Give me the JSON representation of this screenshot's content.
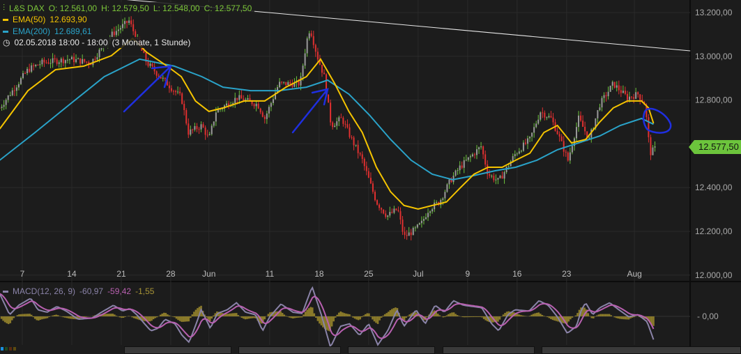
{
  "legend": {
    "symbol": "L&S DAX",
    "open": "O: 12.561,00",
    "high": "H: 12.579,50",
    "low": "L: 12.548,00",
    "close": "C: 12.577,50",
    "ema50_label": "EMA(50)",
    "ema50_value": "12.693,90",
    "ema200_label": "EMA(200)",
    "ema200_value": "12.689,61",
    "period": "02.05.2018 18:00 - 18:00",
    "range": "(3 Monate, 1 Stunde)"
  },
  "macd_legend": {
    "label": "MACD(12, 26, 9)",
    "macd": "-60,97",
    "signal": "-59,42",
    "hist": "-1,55"
  },
  "last_price_tag": "12.577,50",
  "colors": {
    "up": "#6cc43c",
    "down": "#e03030",
    "ema50": "#f5c400",
    "ema200": "#2aa3c9",
    "macd": "#8a83a8",
    "signal": "#b860b0",
    "hist": "#8a7a2a",
    "annotation": "#1f2fe0"
  },
  "chart_data": {
    "type": "line",
    "title": "L&S DAX (3 Monate, 1 Stunde)",
    "x_unit": "days since 7 May 2018",
    "xlim": [
      -3.2,
      94.5
    ],
    "ylim": [
      12000,
      13200
    ],
    "x_ticks": [
      {
        "d": 0,
        "label": "7"
      },
      {
        "d": 7,
        "label": "14"
      },
      {
        "d": 14,
        "label": "21"
      },
      {
        "d": 21,
        "label": "28"
      },
      {
        "d": 26.4,
        "label": "Jun"
      },
      {
        "d": 35,
        "label": "11"
      },
      {
        "d": 42,
        "label": "18"
      },
      {
        "d": 49,
        "label": "25"
      },
      {
        "d": 56,
        "label": "Jul"
      },
      {
        "d": 63,
        "label": "9"
      },
      {
        "d": 70,
        "label": "16"
      },
      {
        "d": 77,
        "label": "23"
      },
      {
        "d": 86.6,
        "label": "Aug"
      }
    ],
    "y_ticks": [
      {
        "v": 13200,
        "label": "13.200,00"
      },
      {
        "v": 13000,
        "label": "13.000,00"
      },
      {
        "v": 12800,
        "label": "12.800,00"
      },
      {
        "v": 12600,
        "label": "12.600,00"
      },
      {
        "v": 12400,
        "label": "12.400,00"
      },
      {
        "v": 12200,
        "label": "12.200,00"
      },
      {
        "v": 12000,
        "label": "12.000,00"
      }
    ],
    "price": [
      [
        -3.2,
        12764
      ],
      [
        0.8,
        12939
      ],
      [
        2.8,
        12971
      ],
      [
        6.7,
        12987
      ],
      [
        9.7,
        12971
      ],
      [
        12.6,
        13098
      ],
      [
        15.1,
        13162
      ],
      [
        17.6,
        12971
      ],
      [
        19.5,
        12907
      ],
      [
        22.5,
        12811
      ],
      [
        23.5,
        12652
      ],
      [
        25.4,
        12684
      ],
      [
        26.4,
        12620
      ],
      [
        27.4,
        12748
      ],
      [
        30.4,
        12811
      ],
      [
        33.3,
        12780
      ],
      [
        34.3,
        12716
      ],
      [
        36.3,
        12875
      ],
      [
        39.3,
        12875
      ],
      [
        40.2,
        13066
      ],
      [
        40.7,
        13130
      ],
      [
        41.7,
        13003
      ],
      [
        42.7,
        12907
      ],
      [
        43.7,
        12684
      ],
      [
        45.2,
        12716
      ],
      [
        46.6,
        12620
      ],
      [
        48.1,
        12525
      ],
      [
        50.1,
        12334
      ],
      [
        51.6,
        12270
      ],
      [
        53.1,
        12302
      ],
      [
        54.0,
        12174
      ],
      [
        55.5,
        12206
      ],
      [
        56.5,
        12238
      ],
      [
        57.5,
        12302
      ],
      [
        59.0,
        12334
      ],
      [
        60.5,
        12429
      ],
      [
        61.9,
        12493
      ],
      [
        64.9,
        12588
      ],
      [
        65.9,
        12461
      ],
      [
        67.4,
        12429
      ],
      [
        69.8,
        12557
      ],
      [
        71.8,
        12620
      ],
      [
        73.3,
        12748
      ],
      [
        74.8,
        12716
      ],
      [
        75.7,
        12652
      ],
      [
        77.2,
        12525
      ],
      [
        78.7,
        12716
      ],
      [
        80.2,
        12620
      ],
      [
        81.7,
        12780
      ],
      [
        83.6,
        12875
      ],
      [
        85.6,
        12811
      ],
      [
        87.1,
        12827
      ],
      [
        88.1,
        12780
      ],
      [
        88.8,
        12557
      ],
      [
        89.5,
        12577.5
      ]
    ],
    "ema50": [
      [
        -3.2,
        12668
      ],
      [
        0.8,
        12843
      ],
      [
        4.7,
        12939
      ],
      [
        8.7,
        12955
      ],
      [
        12.6,
        13003
      ],
      [
        15.6,
        13082
      ],
      [
        17.6,
        13018
      ],
      [
        20.5,
        12955
      ],
      [
        22.5,
        12907
      ],
      [
        24.5,
        12796
      ],
      [
        26.4,
        12748
      ],
      [
        28.4,
        12764
      ],
      [
        31.4,
        12796
      ],
      [
        34.3,
        12796
      ],
      [
        37.3,
        12859
      ],
      [
        40.2,
        12907
      ],
      [
        42.2,
        12987
      ],
      [
        44.2,
        12875
      ],
      [
        46.2,
        12748
      ],
      [
        48.1,
        12652
      ],
      [
        50.1,
        12493
      ],
      [
        52.1,
        12381
      ],
      [
        54.0,
        12318
      ],
      [
        56.0,
        12302
      ],
      [
        58.0,
        12318
      ],
      [
        60.0,
        12334
      ],
      [
        61.9,
        12397
      ],
      [
        63.9,
        12461
      ],
      [
        65.9,
        12493
      ],
      [
        67.9,
        12493
      ],
      [
        69.8,
        12525
      ],
      [
        71.8,
        12557
      ],
      [
        73.8,
        12652
      ],
      [
        75.7,
        12684
      ],
      [
        77.7,
        12604
      ],
      [
        79.7,
        12620
      ],
      [
        81.7,
        12700
      ],
      [
        83.6,
        12764
      ],
      [
        85.6,
        12796
      ],
      [
        87.6,
        12796
      ],
      [
        88.6,
        12764
      ],
      [
        89.3,
        12693.9
      ]
    ],
    "ema200": [
      [
        -3.2,
        12525
      ],
      [
        1.8,
        12652
      ],
      [
        6.7,
        12780
      ],
      [
        11.6,
        12907
      ],
      [
        16.6,
        12987
      ],
      [
        21.5,
        12955
      ],
      [
        25.4,
        12907
      ],
      [
        28.4,
        12859
      ],
      [
        32.3,
        12843
      ],
      [
        36.3,
        12843
      ],
      [
        40.2,
        12859
      ],
      [
        43.2,
        12891
      ],
      [
        46.2,
        12827
      ],
      [
        49.1,
        12732
      ],
      [
        52.1,
        12620
      ],
      [
        55.0,
        12525
      ],
      [
        58.0,
        12461
      ],
      [
        60.9,
        12436
      ],
      [
        63.9,
        12455
      ],
      [
        66.9,
        12477
      ],
      [
        69.8,
        12493
      ],
      [
        72.8,
        12525
      ],
      [
        75.7,
        12573
      ],
      [
        78.7,
        12604
      ],
      [
        81.7,
        12636
      ],
      [
        84.6,
        12684
      ],
      [
        87.6,
        12716
      ],
      [
        89.3,
        12689.61
      ]
    ],
    "trendline": [
      [
        30.4,
        13213
      ],
      [
        94.5,
        13025
      ]
    ],
    "macd_panel": {
      "zero_label": "0,00",
      "macd": [
        [
          -3.2,
          55
        ],
        [
          -1.8,
          4
        ],
        [
          -0.5,
          27
        ],
        [
          1.2,
          44
        ],
        [
          2.2,
          16
        ],
        [
          3.5,
          10
        ],
        [
          4.9,
          24
        ],
        [
          6.2,
          13
        ],
        [
          7.9,
          -7
        ],
        [
          9.9,
          -4
        ],
        [
          11.2,
          10
        ],
        [
          12.9,
          27
        ],
        [
          14.2,
          13
        ],
        [
          15.2,
          19
        ],
        [
          16.2,
          4
        ],
        [
          17.6,
          -24
        ],
        [
          18.2,
          -35
        ],
        [
          19.2,
          -29
        ],
        [
          20.2,
          -7
        ],
        [
          21.6,
          -18
        ],
        [
          22.6,
          -46
        ],
        [
          23.6,
          -63
        ],
        [
          24.6,
          -18
        ],
        [
          25.3,
          16
        ],
        [
          26.3,
          -18
        ],
        [
          26.6,
          -29
        ],
        [
          27.6,
          7
        ],
        [
          29.0,
          16
        ],
        [
          30.3,
          33
        ],
        [
          31.6,
          10
        ],
        [
          33.0,
          4
        ],
        [
          34.0,
          -35
        ],
        [
          35.0,
          -1
        ],
        [
          36.6,
          30
        ],
        [
          38.3,
          10
        ],
        [
          39.6,
          7
        ],
        [
          41.0,
          72
        ],
        [
          42.3,
          4
        ],
        [
          43.6,
          -75
        ],
        [
          45.0,
          -24
        ],
        [
          46.3,
          -18
        ],
        [
          47.7,
          -46
        ],
        [
          49.0,
          -18
        ],
        [
          50.3,
          -69
        ],
        [
          51.7,
          -35
        ],
        [
          53.0,
          16
        ],
        [
          54.0,
          -24
        ],
        [
          55.0,
          -1
        ],
        [
          55.7,
          16
        ],
        [
          57.0,
          -18
        ],
        [
          58.4,
          27
        ],
        [
          59.7,
          10
        ],
        [
          61.0,
          38
        ],
        [
          62.4,
          27
        ],
        [
          63.7,
          24
        ],
        [
          65.0,
          21
        ],
        [
          66.4,
          -18
        ],
        [
          67.4,
          -35
        ],
        [
          68.7,
          4
        ],
        [
          69.7,
          16
        ],
        [
          71.7,
          13
        ],
        [
          73.1,
          38
        ],
        [
          74.4,
          27
        ],
        [
          75.7,
          -1
        ],
        [
          77.1,
          -41
        ],
        [
          78.4,
          -24
        ],
        [
          79.1,
          16
        ],
        [
          79.7,
          33
        ],
        [
          80.7,
          4
        ],
        [
          81.7,
          21
        ],
        [
          83.1,
          33
        ],
        [
          84.4,
          16
        ],
        [
          85.8,
          -1
        ],
        [
          87.1,
          4
        ],
        [
          88.4,
          -13
        ],
        [
          89.4,
          -61
        ]
      ]
    }
  }
}
